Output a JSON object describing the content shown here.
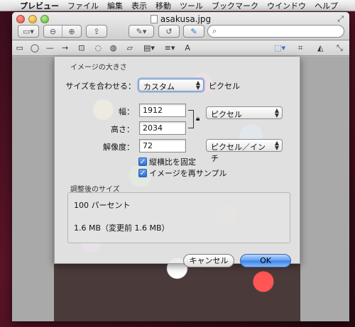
{
  "menubar": {
    "items": [
      "プレビュー",
      "ファイル",
      "編集",
      "表示",
      "移動",
      "ツール",
      "ブックマーク",
      "ウインドウ",
      "ヘルプ"
    ]
  },
  "window": {
    "title": "asakusa.jpg"
  },
  "toolbar": {
    "search_placeholder": ""
  },
  "dialog": {
    "image_size_section": "イメージの大きさ",
    "fit_label": "サイズを合わせる：",
    "fit_value": "カスタム",
    "fit_unit": "ピクセル",
    "width_label": "幅：",
    "width_value": "1912",
    "height_label": "高さ：",
    "height_value": "2034",
    "unit_value": "ピクセル",
    "resolution_label": "解像度：",
    "resolution_value": "72",
    "resolution_unit": "ピクセル／インチ",
    "scale_proportionally": "縦横比を固定",
    "resample": "イメージを再サンプル",
    "result_section": "調整後のサイズ",
    "percent_text": "100 パーセント",
    "size_text": "1.6 MB（変更前 1.6 MB）",
    "cancel": "キャンセル",
    "ok": "OK"
  },
  "colors": {
    "accent": "#3a82e8",
    "desktop": "#5a1427"
  }
}
